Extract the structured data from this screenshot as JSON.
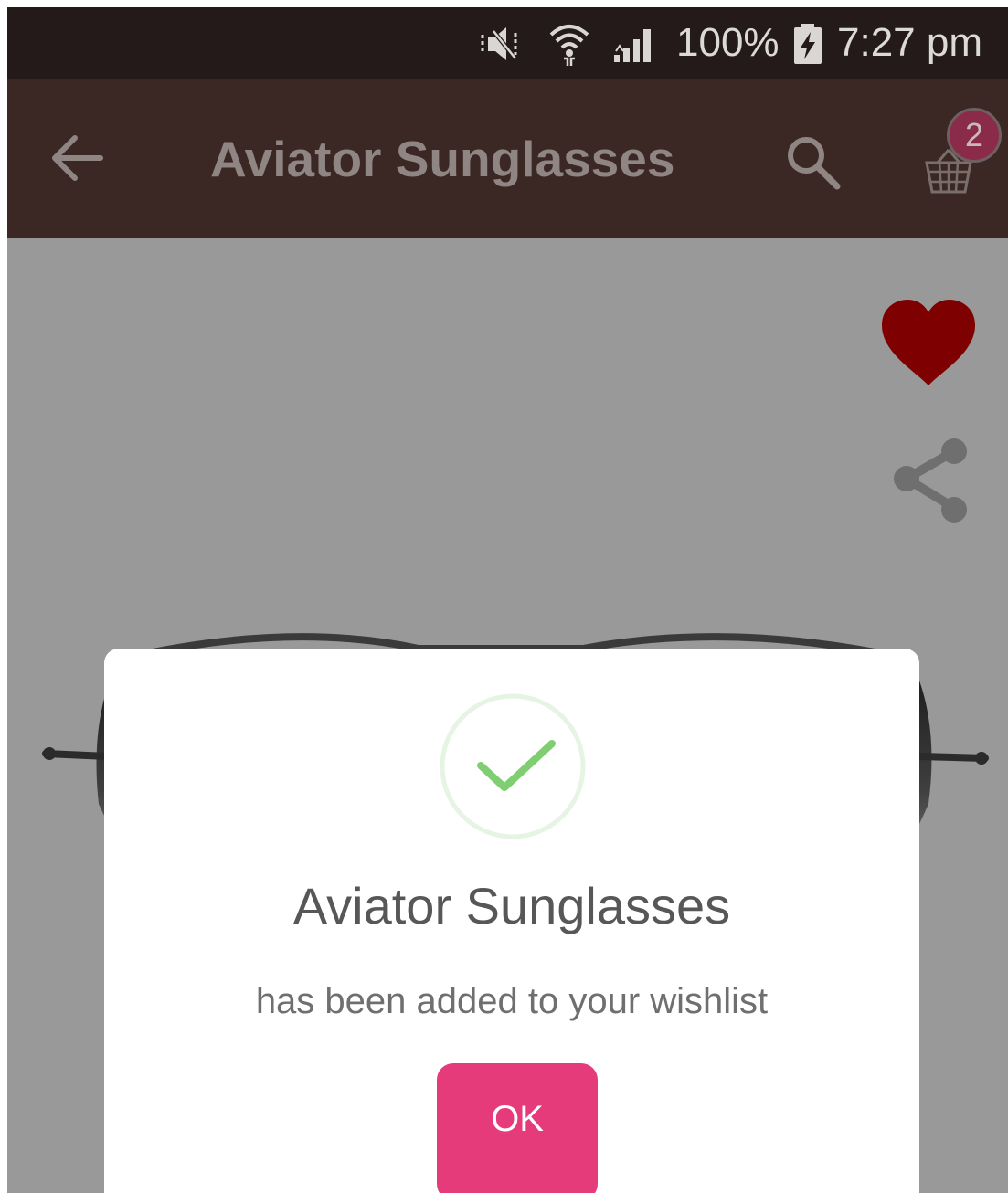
{
  "status_bar": {
    "battery_percent": "100%",
    "time": "7:27 pm",
    "icons": [
      "mute-icon",
      "wifi-icon",
      "signal-icon",
      "battery-charging-icon"
    ]
  },
  "toolbar": {
    "title": "Aviator Sunglasses",
    "back_icon": "arrow-left-icon",
    "search_icon": "search-icon",
    "cart_icon": "basket-icon",
    "cart_count": "2",
    "background_color": "#3b2825"
  },
  "product": {
    "wishlist_icon": "heart-icon",
    "share_icon": "share-icon",
    "wishlist_color": "#7f0000",
    "image": "aviator-sunglasses"
  },
  "dialog": {
    "icon": "success-check-icon",
    "title": "Aviator Sunglasses",
    "message": "has been added to your wishlist",
    "ok_label": "OK",
    "ok_color": "#e63b7a",
    "check_color": "#7fcf72"
  }
}
